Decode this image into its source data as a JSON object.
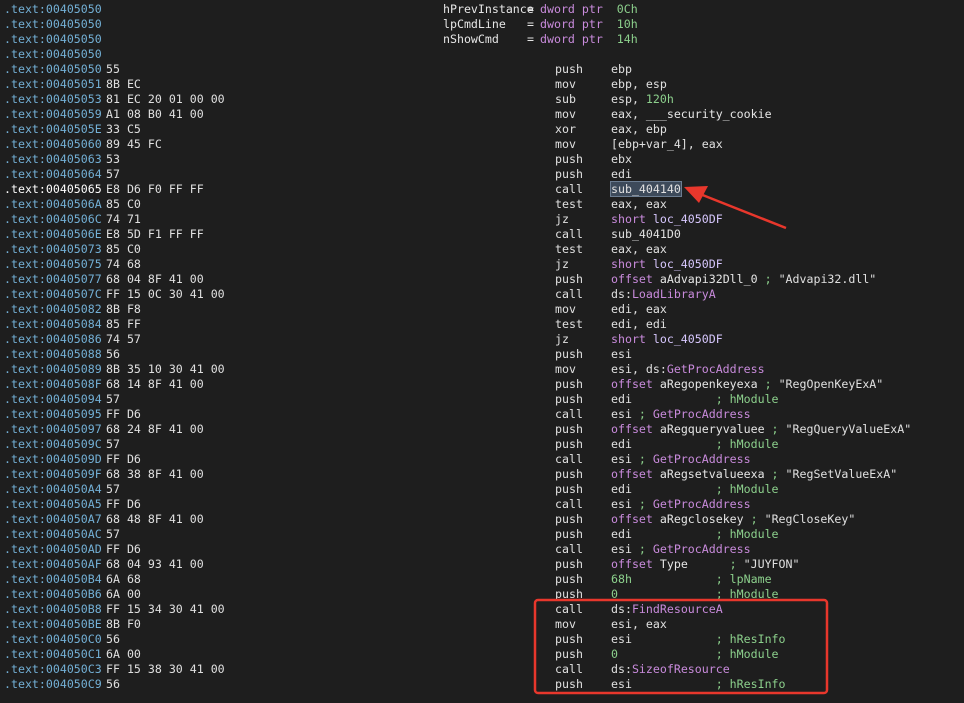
{
  "rows": [
    {
      "addr": ".text:00405050",
      "kind": "var",
      "vname": "hPrevInstance",
      "def": [
        [
          "c-kw",
          "dword ptr  "
        ],
        [
          "c-num",
          "0Ch"
        ]
      ]
    },
    {
      "addr": ".text:00405050",
      "kind": "var",
      "vname": "lpCmdLine",
      "def": [
        [
          "c-kw",
          "dword ptr  "
        ],
        [
          "c-num",
          "10h"
        ]
      ]
    },
    {
      "addr": ".text:00405050",
      "kind": "var",
      "vname": "nShowCmd",
      "def": [
        [
          "c-kw",
          "dword ptr  "
        ],
        [
          "c-num",
          "14h"
        ]
      ]
    },
    {
      "addr": ".text:00405050",
      "kind": "blank"
    },
    {
      "addr": ".text:00405050",
      "bytes": "55",
      "mn": "push",
      "op": [
        [
          "",
          "ebp"
        ]
      ]
    },
    {
      "addr": ".text:00405051",
      "bytes": "8B EC",
      "mn": "mov",
      "op": [
        [
          "",
          "ebp, esp"
        ]
      ]
    },
    {
      "addr": ".text:00405053",
      "bytes": "81 EC 20 01 00 00",
      "mn": "sub",
      "op": [
        [
          "",
          "esp, "
        ],
        [
          "c-num",
          "120h"
        ]
      ]
    },
    {
      "addr": ".text:00405059",
      "bytes": "A1 08 B0 41 00",
      "mn": "mov",
      "op": [
        [
          "",
          "eax, "
        ],
        [
          "c-name",
          "___security_cookie"
        ]
      ]
    },
    {
      "addr": ".text:0040505E",
      "bytes": "33 C5",
      "mn": "xor",
      "op": [
        [
          "",
          "eax, ebp"
        ]
      ]
    },
    {
      "addr": ".text:00405060",
      "bytes": "89 45 FC",
      "mn": "mov",
      "op": [
        [
          "",
          "[ebp+var_4], eax"
        ]
      ]
    },
    {
      "addr": ".text:00405063",
      "bytes": "53",
      "mn": "push",
      "op": [
        [
          "",
          "ebx"
        ]
      ]
    },
    {
      "addr": ".text:00405064",
      "bytes": "57",
      "mn": "push",
      "op": [
        [
          "",
          "edi"
        ]
      ]
    },
    {
      "addr": ".text:00405065",
      "bytes": "E8 D6 F0 FF FF",
      "mn": "call",
      "op": [
        [
          "hl",
          "sub_404140"
        ]
      ],
      "current": true
    },
    {
      "addr": ".text:0040506A",
      "bytes": "85 C0",
      "mn": "test",
      "op": [
        [
          "",
          "eax, eax"
        ]
      ]
    },
    {
      "addr": ".text:0040506C",
      "bytes": "74 71",
      "mn": "jz",
      "op": [
        [
          "c-kw",
          "short "
        ],
        [
          "c-lbl",
          "loc_4050DF"
        ]
      ]
    },
    {
      "addr": ".text:0040506E",
      "bytes": "E8 5D F1 FF FF",
      "mn": "call",
      "op": [
        [
          "",
          "sub_4041D0"
        ]
      ]
    },
    {
      "addr": ".text:00405073",
      "bytes": "85 C0",
      "mn": "test",
      "op": [
        [
          "",
          "eax, eax"
        ]
      ]
    },
    {
      "addr": ".text:00405075",
      "bytes": "74 68",
      "mn": "jz",
      "op": [
        [
          "c-kw",
          "short "
        ],
        [
          "c-lbl",
          "loc_4050DF"
        ]
      ]
    },
    {
      "addr": ".text:00405077",
      "bytes": "68 04 8F 41 00",
      "mn": "push",
      "op": [
        [
          "c-kw",
          "offset "
        ],
        [
          "c-name",
          "aAdvapi32Dll_0"
        ],
        [
          "c-cmt",
          " ; "
        ],
        [
          "c-str",
          "\"Advapi32.dll\""
        ]
      ]
    },
    {
      "addr": ".text:0040507C",
      "bytes": "FF 15 0C 30 41 00",
      "mn": "call",
      "op": [
        [
          "",
          "ds:"
        ],
        [
          "c-api",
          "LoadLibraryA"
        ]
      ]
    },
    {
      "addr": ".text:00405082",
      "bytes": "8B F8",
      "mn": "mov",
      "op": [
        [
          "",
          "edi, eax"
        ]
      ]
    },
    {
      "addr": ".text:00405084",
      "bytes": "85 FF",
      "mn": "test",
      "op": [
        [
          "",
          "edi, edi"
        ]
      ]
    },
    {
      "addr": ".text:00405086",
      "bytes": "74 57",
      "mn": "jz",
      "op": [
        [
          "c-kw",
          "short "
        ],
        [
          "c-lbl",
          "loc_4050DF"
        ]
      ]
    },
    {
      "addr": ".text:00405088",
      "bytes": "56",
      "mn": "push",
      "op": [
        [
          "",
          "esi"
        ]
      ]
    },
    {
      "addr": ".text:00405089",
      "bytes": "8B 35 10 30 41 00",
      "mn": "mov",
      "op": [
        [
          "",
          "esi, ds:"
        ],
        [
          "c-api",
          "GetProcAddress"
        ]
      ]
    },
    {
      "addr": ".text:0040508F",
      "bytes": "68 14 8F 41 00",
      "mn": "push",
      "op": [
        [
          "c-kw",
          "offset "
        ],
        [
          "c-name",
          "aRegopenkeyexa"
        ],
        [
          "c-cmt",
          " ; "
        ],
        [
          "c-str",
          "\"RegOpenKeyExA\""
        ]
      ]
    },
    {
      "addr": ".text:00405094",
      "bytes": "57",
      "mn": "push",
      "op": [
        [
          "",
          "edi            "
        ],
        [
          "c-cmt",
          "; hModule"
        ]
      ]
    },
    {
      "addr": ".text:00405095",
      "bytes": "FF D6",
      "mn": "call",
      "op": [
        [
          "",
          "esi "
        ],
        [
          "c-cmt",
          "; "
        ],
        [
          "c-api",
          "GetProcAddress"
        ]
      ]
    },
    {
      "addr": ".text:00405097",
      "bytes": "68 24 8F 41 00",
      "mn": "push",
      "op": [
        [
          "c-kw",
          "offset "
        ],
        [
          "c-name",
          "aRegqueryvaluee"
        ],
        [
          "c-cmt",
          " ; "
        ],
        [
          "c-str",
          "\"RegQueryValueExA\""
        ]
      ]
    },
    {
      "addr": ".text:0040509C",
      "bytes": "57",
      "mn": "push",
      "op": [
        [
          "",
          "edi            "
        ],
        [
          "c-cmt",
          "; hModule"
        ]
      ]
    },
    {
      "addr": ".text:0040509D",
      "bytes": "FF D6",
      "mn": "call",
      "op": [
        [
          "",
          "esi "
        ],
        [
          "c-cmt",
          "; "
        ],
        [
          "c-api",
          "GetProcAddress"
        ]
      ]
    },
    {
      "addr": ".text:0040509F",
      "bytes": "68 38 8F 41 00",
      "mn": "push",
      "op": [
        [
          "c-kw",
          "offset "
        ],
        [
          "c-name",
          "aRegsetvalueexa"
        ],
        [
          "c-cmt",
          " ; "
        ],
        [
          "c-str",
          "\"RegSetValueExA\""
        ]
      ]
    },
    {
      "addr": ".text:004050A4",
      "bytes": "57",
      "mn": "push",
      "op": [
        [
          "",
          "edi            "
        ],
        [
          "c-cmt",
          "; hModule"
        ]
      ]
    },
    {
      "addr": ".text:004050A5",
      "bytes": "FF D6",
      "mn": "call",
      "op": [
        [
          "",
          "esi "
        ],
        [
          "c-cmt",
          "; "
        ],
        [
          "c-api",
          "GetProcAddress"
        ]
      ]
    },
    {
      "addr": ".text:004050A7",
      "bytes": "68 48 8F 41 00",
      "mn": "push",
      "op": [
        [
          "c-kw",
          "offset "
        ],
        [
          "c-name",
          "aRegclosekey"
        ],
        [
          "c-cmt",
          " ; "
        ],
        [
          "c-str",
          "\"RegCloseKey\""
        ]
      ]
    },
    {
      "addr": ".text:004050AC",
      "bytes": "57",
      "mn": "push",
      "op": [
        [
          "",
          "edi            "
        ],
        [
          "c-cmt",
          "; hModule"
        ]
      ]
    },
    {
      "addr": ".text:004050AD",
      "bytes": "FF D6",
      "mn": "call",
      "op": [
        [
          "",
          "esi "
        ],
        [
          "c-cmt",
          "; "
        ],
        [
          "c-api",
          "GetProcAddress"
        ]
      ]
    },
    {
      "addr": ".text:004050AF",
      "bytes": "68 04 93 41 00",
      "mn": "push",
      "op": [
        [
          "c-kw",
          "offset "
        ],
        [
          "c-name",
          "Type"
        ],
        [
          "c-cmt",
          "      ; "
        ],
        [
          "c-str",
          "\"JUYFON\""
        ]
      ]
    },
    {
      "addr": ".text:004050B4",
      "bytes": "6A 68",
      "mn": "push",
      "op": [
        [
          "c-num",
          "68h"
        ],
        [
          "c-cmt",
          "            ; lpName"
        ]
      ]
    },
    {
      "addr": ".text:004050B6",
      "bytes": "6A 00",
      "mn": "push",
      "op": [
        [
          "c-num",
          "0"
        ],
        [
          "c-cmt",
          "              ; hModule"
        ]
      ]
    },
    {
      "addr": ".text:004050B8",
      "bytes": "FF 15 34 30 41 00",
      "mn": "call",
      "op": [
        [
          "",
          "ds:"
        ],
        [
          "c-api",
          "FindResourceA"
        ]
      ]
    },
    {
      "addr": ".text:004050BE",
      "bytes": "8B F0",
      "mn": "mov",
      "op": [
        [
          "",
          "esi, eax"
        ]
      ]
    },
    {
      "addr": ".text:004050C0",
      "bytes": "56",
      "mn": "push",
      "op": [
        [
          "",
          "esi            "
        ],
        [
          "c-cmt",
          "; hResInfo"
        ]
      ]
    },
    {
      "addr": ".text:004050C1",
      "bytes": "6A 00",
      "mn": "push",
      "op": [
        [
          "c-num",
          "0"
        ],
        [
          "c-cmt",
          "              ; hModule"
        ]
      ]
    },
    {
      "addr": ".text:004050C3",
      "bytes": "FF 15 38 30 41 00",
      "mn": "call",
      "op": [
        [
          "",
          "ds:"
        ],
        [
          "c-api",
          "SizeofResource"
        ]
      ]
    },
    {
      "addr": ".text:004050C9",
      "bytes": "56",
      "mn": "push",
      "op": [
        [
          "",
          "esi            "
        ],
        [
          "c-cmt",
          "; hResInfo"
        ]
      ]
    }
  ],
  "annotation": {
    "color": "#e8372c"
  }
}
